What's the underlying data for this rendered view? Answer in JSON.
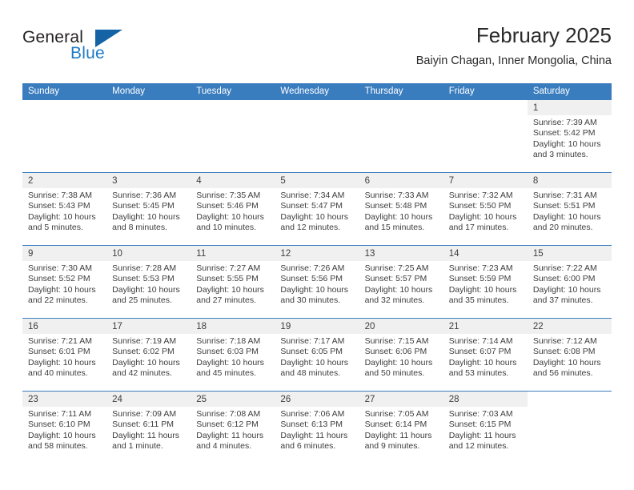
{
  "brand": {
    "name_top": "General",
    "name_bottom": "Blue",
    "color_dark": "#231f20",
    "color_blue": "#1f7ac4",
    "triangle_color": "#1464a5"
  },
  "header": {
    "title": "February 2025",
    "subtitle": "Baiyin Chagan, Inner Mongolia, China"
  },
  "theme": {
    "header_bg": "#3a7dbf",
    "header_text": "#ffffff",
    "daynum_bg": "#f0f0f0",
    "text": "#3d3d3d",
    "row_rule": "#3a7dbf"
  },
  "weekdays": [
    "Sunday",
    "Monday",
    "Tuesday",
    "Wednesday",
    "Thursday",
    "Friday",
    "Saturday"
  ],
  "labels": {
    "sunrise": "Sunrise:",
    "sunset": "Sunset:",
    "daylight": "Daylight:"
  },
  "weeks": [
    [
      {
        "day": "",
        "empty": true
      },
      {
        "day": "",
        "empty": true
      },
      {
        "day": "",
        "empty": true
      },
      {
        "day": "",
        "empty": true
      },
      {
        "day": "",
        "empty": true
      },
      {
        "day": "",
        "empty": true
      },
      {
        "day": "1",
        "sunrise": "Sunrise: 7:39 AM",
        "sunset": "Sunset: 5:42 PM",
        "daylight": "Daylight: 10 hours and 3 minutes."
      }
    ],
    [
      {
        "day": "2",
        "sunrise": "Sunrise: 7:38 AM",
        "sunset": "Sunset: 5:43 PM",
        "daylight": "Daylight: 10 hours and 5 minutes."
      },
      {
        "day": "3",
        "sunrise": "Sunrise: 7:36 AM",
        "sunset": "Sunset: 5:45 PM",
        "daylight": "Daylight: 10 hours and 8 minutes."
      },
      {
        "day": "4",
        "sunrise": "Sunrise: 7:35 AM",
        "sunset": "Sunset: 5:46 PM",
        "daylight": "Daylight: 10 hours and 10 minutes."
      },
      {
        "day": "5",
        "sunrise": "Sunrise: 7:34 AM",
        "sunset": "Sunset: 5:47 PM",
        "daylight": "Daylight: 10 hours and 12 minutes."
      },
      {
        "day": "6",
        "sunrise": "Sunrise: 7:33 AM",
        "sunset": "Sunset: 5:48 PM",
        "daylight": "Daylight: 10 hours and 15 minutes."
      },
      {
        "day": "7",
        "sunrise": "Sunrise: 7:32 AM",
        "sunset": "Sunset: 5:50 PM",
        "daylight": "Daylight: 10 hours and 17 minutes."
      },
      {
        "day": "8",
        "sunrise": "Sunrise: 7:31 AM",
        "sunset": "Sunset: 5:51 PM",
        "daylight": "Daylight: 10 hours and 20 minutes."
      }
    ],
    [
      {
        "day": "9",
        "sunrise": "Sunrise: 7:30 AM",
        "sunset": "Sunset: 5:52 PM",
        "daylight": "Daylight: 10 hours and 22 minutes."
      },
      {
        "day": "10",
        "sunrise": "Sunrise: 7:28 AM",
        "sunset": "Sunset: 5:53 PM",
        "daylight": "Daylight: 10 hours and 25 minutes."
      },
      {
        "day": "11",
        "sunrise": "Sunrise: 7:27 AM",
        "sunset": "Sunset: 5:55 PM",
        "daylight": "Daylight: 10 hours and 27 minutes."
      },
      {
        "day": "12",
        "sunrise": "Sunrise: 7:26 AM",
        "sunset": "Sunset: 5:56 PM",
        "daylight": "Daylight: 10 hours and 30 minutes."
      },
      {
        "day": "13",
        "sunrise": "Sunrise: 7:25 AM",
        "sunset": "Sunset: 5:57 PM",
        "daylight": "Daylight: 10 hours and 32 minutes."
      },
      {
        "day": "14",
        "sunrise": "Sunrise: 7:23 AM",
        "sunset": "Sunset: 5:59 PM",
        "daylight": "Daylight: 10 hours and 35 minutes."
      },
      {
        "day": "15",
        "sunrise": "Sunrise: 7:22 AM",
        "sunset": "Sunset: 6:00 PM",
        "daylight": "Daylight: 10 hours and 37 minutes."
      }
    ],
    [
      {
        "day": "16",
        "sunrise": "Sunrise: 7:21 AM",
        "sunset": "Sunset: 6:01 PM",
        "daylight": "Daylight: 10 hours and 40 minutes."
      },
      {
        "day": "17",
        "sunrise": "Sunrise: 7:19 AM",
        "sunset": "Sunset: 6:02 PM",
        "daylight": "Daylight: 10 hours and 42 minutes."
      },
      {
        "day": "18",
        "sunrise": "Sunrise: 7:18 AM",
        "sunset": "Sunset: 6:03 PM",
        "daylight": "Daylight: 10 hours and 45 minutes."
      },
      {
        "day": "19",
        "sunrise": "Sunrise: 7:17 AM",
        "sunset": "Sunset: 6:05 PM",
        "daylight": "Daylight: 10 hours and 48 minutes."
      },
      {
        "day": "20",
        "sunrise": "Sunrise: 7:15 AM",
        "sunset": "Sunset: 6:06 PM",
        "daylight": "Daylight: 10 hours and 50 minutes."
      },
      {
        "day": "21",
        "sunrise": "Sunrise: 7:14 AM",
        "sunset": "Sunset: 6:07 PM",
        "daylight": "Daylight: 10 hours and 53 minutes."
      },
      {
        "day": "22",
        "sunrise": "Sunrise: 7:12 AM",
        "sunset": "Sunset: 6:08 PM",
        "daylight": "Daylight: 10 hours and 56 minutes."
      }
    ],
    [
      {
        "day": "23",
        "sunrise": "Sunrise: 7:11 AM",
        "sunset": "Sunset: 6:10 PM",
        "daylight": "Daylight: 10 hours and 58 minutes."
      },
      {
        "day": "24",
        "sunrise": "Sunrise: 7:09 AM",
        "sunset": "Sunset: 6:11 PM",
        "daylight": "Daylight: 11 hours and 1 minute."
      },
      {
        "day": "25",
        "sunrise": "Sunrise: 7:08 AM",
        "sunset": "Sunset: 6:12 PM",
        "daylight": "Daylight: 11 hours and 4 minutes."
      },
      {
        "day": "26",
        "sunrise": "Sunrise: 7:06 AM",
        "sunset": "Sunset: 6:13 PM",
        "daylight": "Daylight: 11 hours and 6 minutes."
      },
      {
        "day": "27",
        "sunrise": "Sunrise: 7:05 AM",
        "sunset": "Sunset: 6:14 PM",
        "daylight": "Daylight: 11 hours and 9 minutes."
      },
      {
        "day": "28",
        "sunrise": "Sunrise: 7:03 AM",
        "sunset": "Sunset: 6:15 PM",
        "daylight": "Daylight: 11 hours and 12 minutes."
      },
      {
        "day": "",
        "empty": true
      }
    ]
  ]
}
